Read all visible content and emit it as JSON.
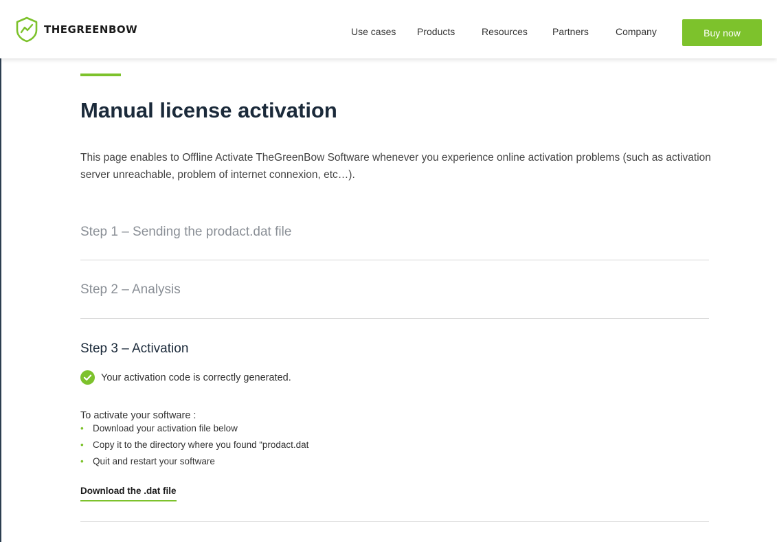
{
  "header": {
    "brand": "THEGREENBOW",
    "nav": [
      {
        "label": "Use cases"
      },
      {
        "label": "Products"
      },
      {
        "label": "Resources"
      },
      {
        "label": "Partners"
      },
      {
        "label": "Company"
      }
    ],
    "cta_label": "Buy now"
  },
  "main": {
    "title": "Manual license activation",
    "intro": "This page enables to Offline Activate TheGreenBow Software whenever you experience online activation problems (such as activation server unreachable, problem of internet connexion, etc…).",
    "steps": [
      {
        "label": "Step 1 – Sending the prodact.dat file"
      },
      {
        "label": "Step 2 – Analysis"
      },
      {
        "label": "Step 3 – Activation"
      }
    ],
    "success_message": "Your activation code is correctly generated.",
    "instructions_title": "To activate your software :",
    "instructions": [
      "Download your activation file below",
      "Copy it to the directory where you found “prodact.dat",
      "Quit and restart your software"
    ],
    "download_label": "Download the .dat file"
  },
  "colors": {
    "accent": "#7dc22c",
    "heading": "#1b2a3a",
    "muted": "#8a8f96"
  },
  "icons": {
    "logo": "shield-trend-icon",
    "success": "check-circle-icon"
  }
}
